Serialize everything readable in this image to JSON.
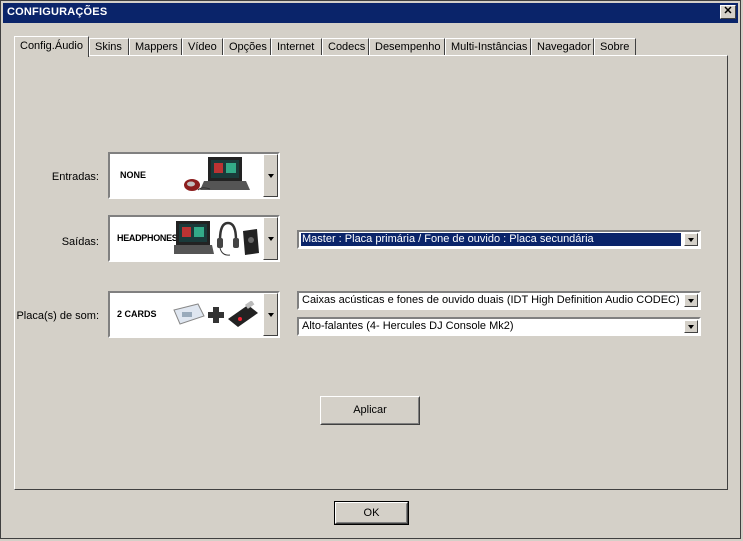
{
  "window": {
    "title": "CONFIGURAÇÕES",
    "close_glyph": "✕"
  },
  "tabs": [
    {
      "label": "Config.Áudio",
      "active": true
    },
    {
      "label": "Skins"
    },
    {
      "label": "Mappers"
    },
    {
      "label": "Vídeo"
    },
    {
      "label": "Opções"
    },
    {
      "label": "Internet"
    },
    {
      "label": "Codecs"
    },
    {
      "label": "Desempenho"
    },
    {
      "label": "Multi-Instâncias"
    },
    {
      "label": "Navegador"
    },
    {
      "label": "Sobre"
    }
  ],
  "inputs": {
    "label": "Entradas:",
    "image_text": "NONE"
  },
  "outputs": {
    "label": "Saídas:",
    "image_text": "HEADPHONES",
    "selected_option": "Master : Placa primária / Fone de ouvido : Placa secundária"
  },
  "soundcards": {
    "label": "Placa(s) de som:",
    "image_text": "2 CARDS",
    "card1": "Caixas acústicas e fones de ouvido duais (IDT High Definition Audio CODEC)",
    "card2": "Alto-falantes (4- Hercules DJ Console Mk2)"
  },
  "buttons": {
    "apply": "Aplicar",
    "ok": "OK"
  },
  "icons": {
    "inputs": [
      "laptop-icon",
      "mouse-icon"
    ],
    "outputs": [
      "laptop-icon",
      "headphones-icon",
      "audio-interface-icon"
    ],
    "soundcards": [
      "soundcard-icon",
      "plus-icon",
      "usb-soundcard-icon"
    ]
  }
}
